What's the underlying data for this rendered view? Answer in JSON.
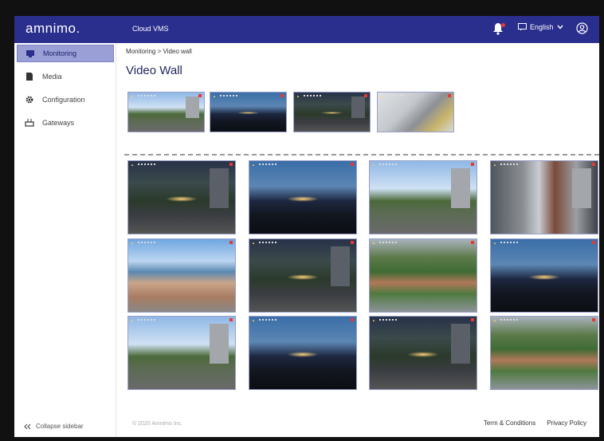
{
  "brand": {
    "logo": "amnimo.",
    "app_name": "Cloud VMS"
  },
  "header": {
    "language": "English",
    "notification_badge": true
  },
  "sidebar": {
    "items": [
      {
        "label": "Monitoring",
        "icon": "monitor-icon",
        "active": true
      },
      {
        "label": "Media",
        "icon": "media-icon",
        "active": false
      },
      {
        "label": "Configuration",
        "icon": "gear-icon",
        "active": false
      },
      {
        "label": "Gateways",
        "icon": "gateway-icon",
        "active": false
      }
    ],
    "collapse_label": "Collapse sidebar"
  },
  "main": {
    "breadcrumb": "Monitoring > Video wall",
    "title": "Video Wall"
  },
  "top_strip": [
    {
      "scene": "day"
    },
    {
      "scene": "night"
    },
    {
      "scene": "nightlot"
    },
    {
      "scene": "machine"
    }
  ],
  "grid": [
    {
      "scene": "nightlot"
    },
    {
      "scene": "night"
    },
    {
      "scene": "day"
    },
    {
      "scene": "street"
    },
    {
      "scene": "beach"
    },
    {
      "scene": "nightlot"
    },
    {
      "scene": "aerial"
    },
    {
      "scene": "night"
    },
    {
      "scene": "day"
    },
    {
      "scene": "night"
    },
    {
      "scene": "nightlot"
    },
    {
      "scene": "aerial"
    }
  ],
  "footer": {
    "copyright": "© 2020 Amnimo Inc.",
    "terms": "Term & Conditions",
    "privacy": "Privacy Policy"
  },
  "colors": {
    "header_bg": "#2a2e8c",
    "active_nav_bg": "#9aa0d6",
    "notification_dot": "#e53935"
  }
}
